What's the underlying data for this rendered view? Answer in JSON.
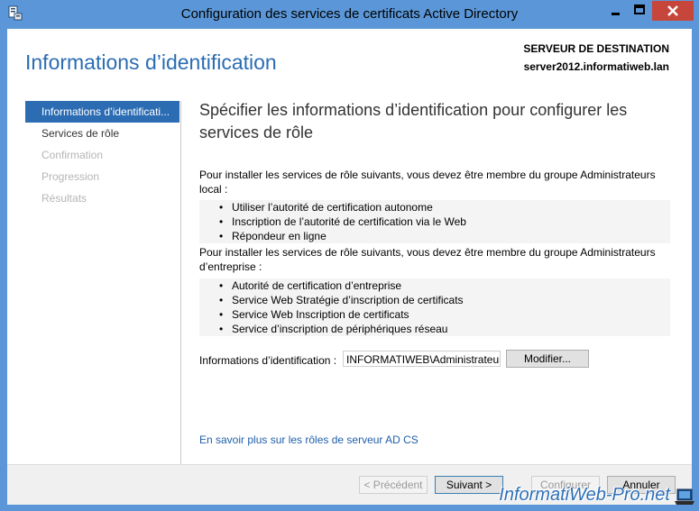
{
  "window": {
    "title": "Configuration des services de certificats Active Directory",
    "minimize_glyph": "–",
    "maximize_glyph": "□",
    "close_glyph": "✕"
  },
  "header": {
    "page_title": "Informations d’identification",
    "destination_label": "SERVEUR DE DESTINATION",
    "destination_server": "server2012.informatiweb.lan"
  },
  "nav": {
    "items": [
      {
        "label": "Informations d’identificati...",
        "state": "active"
      },
      {
        "label": "Services de rôle",
        "state": "enabled"
      },
      {
        "label": "Confirmation",
        "state": "disabled"
      },
      {
        "label": "Progression",
        "state": "disabled"
      },
      {
        "label": "Résultats",
        "state": "disabled"
      }
    ]
  },
  "main": {
    "subtitle": "Spécifier les informations d’identification pour configurer les services de rôle",
    "local_intro": "Pour installer les services de rôle suivants, vous devez être membre du groupe Administrateurs local :",
    "local_roles": [
      "Utiliser l’autorité de certification autonome",
      "Inscription de l’autorité de certification via le Web",
      "Répondeur en ligne"
    ],
    "enterprise_intro": "Pour installer les services de rôle suivants, vous devez être membre du groupe Administrateurs d’entreprise :",
    "enterprise_roles": [
      "Autorité de certification d’entreprise",
      "Service Web Stratégie d’inscription de certificats",
      "Service Web Inscription de certificats",
      "Service d’inscription de périphériques réseau"
    ],
    "credentials_label": "Informations d’identification :",
    "credentials_value": "INFORMATIWEB\\Administrateur",
    "modify_button": "Modifier...",
    "learn_more_link": "En savoir plus sur les rôles de serveur AD CS"
  },
  "footer": {
    "previous": "< Précédent",
    "next": "Suivant >",
    "configure": "Configurer",
    "cancel": "Annuler"
  },
  "watermark": {
    "text": "InformatiWeb-Pro.net"
  },
  "colors": {
    "titlebar": "#5b97d8",
    "accent": "#2b6cb3",
    "close": "#c7463b"
  }
}
